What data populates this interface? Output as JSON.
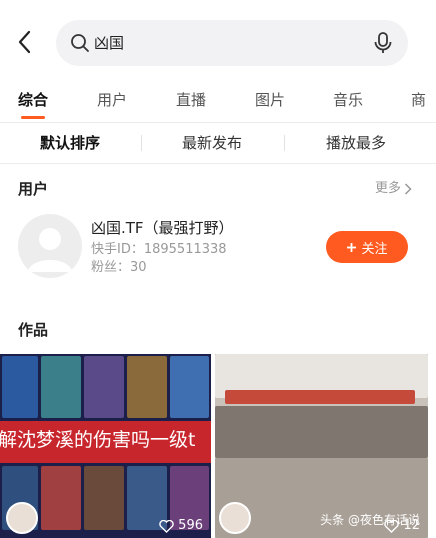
{
  "search": {
    "query": "凶国"
  },
  "tabs": [
    {
      "label": "综合",
      "active": true
    },
    {
      "label": "用户"
    },
    {
      "label": "直播"
    },
    {
      "label": "图片"
    },
    {
      "label": "音乐"
    },
    {
      "label": "商"
    }
  ],
  "sort": [
    {
      "label": "默认排序",
      "active": true
    },
    {
      "label": "最新发布"
    },
    {
      "label": "播放最多"
    }
  ],
  "users_section": {
    "title": "用户",
    "more": "更多"
  },
  "user": {
    "name": "凶国.TF（最强打野）",
    "id_line": "快手ID：1895511338",
    "fans_line": "粉丝：30",
    "follow_label": "关注"
  },
  "works_section": {
    "title": "作品"
  },
  "videos": [
    {
      "overlay": "解沈梦溪的伤害吗一级t",
      "likes": "596"
    },
    {
      "likes": "12"
    }
  ],
  "watermark": "头条 @夜色有话说",
  "colors": {
    "accent": "#ff5a1f",
    "search_bg": "#f2f2f4"
  }
}
